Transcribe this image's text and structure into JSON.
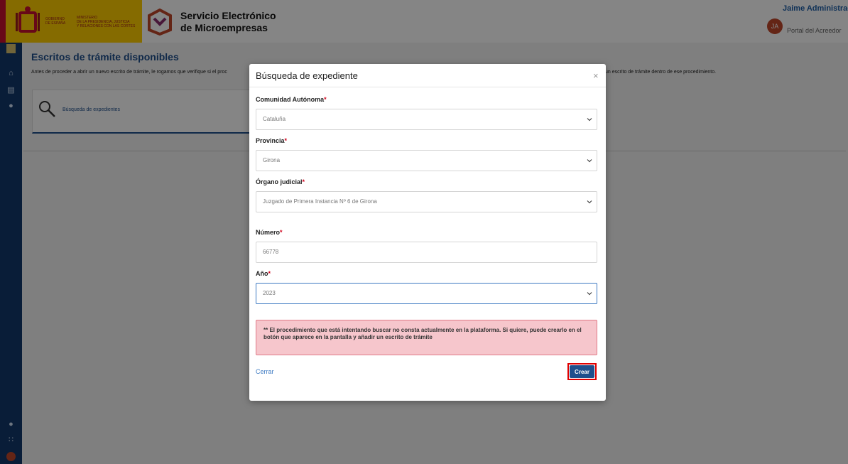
{
  "header": {
    "gov_line1": "GOBIERNO\nDE ESPAÑA",
    "gov_line2": "MINISTERIO\nDE LA PRESIDENCIA, JUSTICIA\nY RELACIONES CON LAS CORTES",
    "app_title_line1": "Servicio Electrónico",
    "app_title_line2": "de Microempresas",
    "user_name": "Jaime AdministradorC",
    "user_initials": "JA",
    "user_portal": "Portal del Acreedor"
  },
  "page": {
    "title": "Escritos de trámite disponibles",
    "description_left": "Antes de proceder a abrir un nuevo escrito de trámite, le rogamos que verifique si el proc",
    "description_right": "un escrito de trámite dentro de ese procedimiento.",
    "search_card_label": "Búsqueda de expedientes"
  },
  "modal": {
    "title": "Búsqueda de expediente",
    "close_symbol": "×",
    "fields": {
      "comunidad": {
        "label": "Comunidad Autónoma",
        "value": "Cataluña"
      },
      "provincia": {
        "label": "Provincia",
        "value": "Girona"
      },
      "organo": {
        "label": "Órgano judicial",
        "value": "Juzgado de Primera Instancia Nº 6 de Girona"
      },
      "numero": {
        "label": "Número",
        "value": "66778"
      },
      "anio": {
        "label": "Año",
        "value": "2023"
      }
    },
    "required_mark": "*",
    "error_message": "** El procedimiento que está intentando buscar no consta actualmente en la plataforma. Si quiere, puede crearlo en el botón que aparece en la pantalla y añadir un escrito de trámite",
    "cerrar_label": "Cerrar",
    "crear_label": "Crear"
  },
  "colors": {
    "primary": "#1f4f8c",
    "sidebar": "#12386b",
    "error_bg": "#f6c6cc",
    "highlight": "#e00000"
  }
}
